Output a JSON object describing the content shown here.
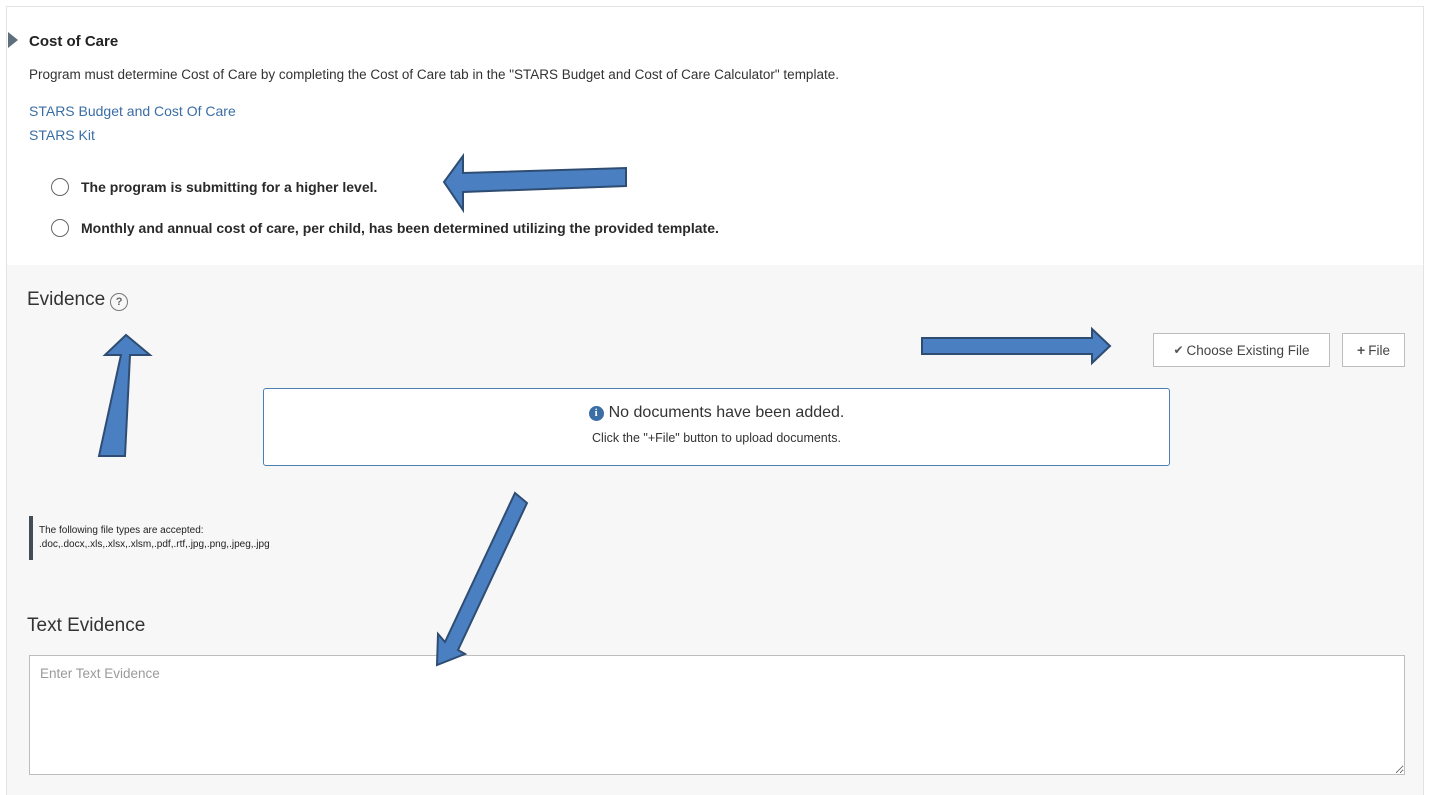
{
  "section": {
    "title": "Cost of Care",
    "description": "Program must determine Cost of Care by completing the Cost of Care tab in the \"STARS Budget and Cost of Care Calculator\" template.",
    "links": [
      {
        "label": "STARS Budget and Cost Of Care"
      },
      {
        "label": "STARS Kit"
      }
    ],
    "options": [
      {
        "label": "The program is submitting for a higher level.",
        "selected": false
      },
      {
        "label": "Monthly and annual cost of care, per child, has been determined utilizing the provided template.",
        "selected": false
      }
    ]
  },
  "evidence": {
    "heading": "Evidence",
    "help_icon": "?",
    "choose_existing_label": "Choose Existing File",
    "add_file_label": "File",
    "empty_title": "No documents have been added.",
    "empty_subtitle": "Click the \"+File\" button to upload documents.",
    "accepted_heading": "The following file types are accepted:",
    "accepted_types": ".doc,.docx,.xls,.xlsx,.xlsm,.pdf,.rtf,.jpg,.png,.jpeg,.jpg"
  },
  "text_evidence": {
    "heading": "Text Evidence",
    "placeholder": "Enter Text Evidence",
    "value": ""
  },
  "icons": {
    "caret": "caret-right-icon",
    "check": "check-icon",
    "plus": "plus-icon",
    "info": "info-circle-icon",
    "help": "question-circle-icon"
  },
  "colors": {
    "link": "#3a6ea5",
    "annotation_arrow": "#4a7fc1",
    "annotation_outline": "#2f4d73",
    "evidence_bg": "#f7f7f7"
  }
}
